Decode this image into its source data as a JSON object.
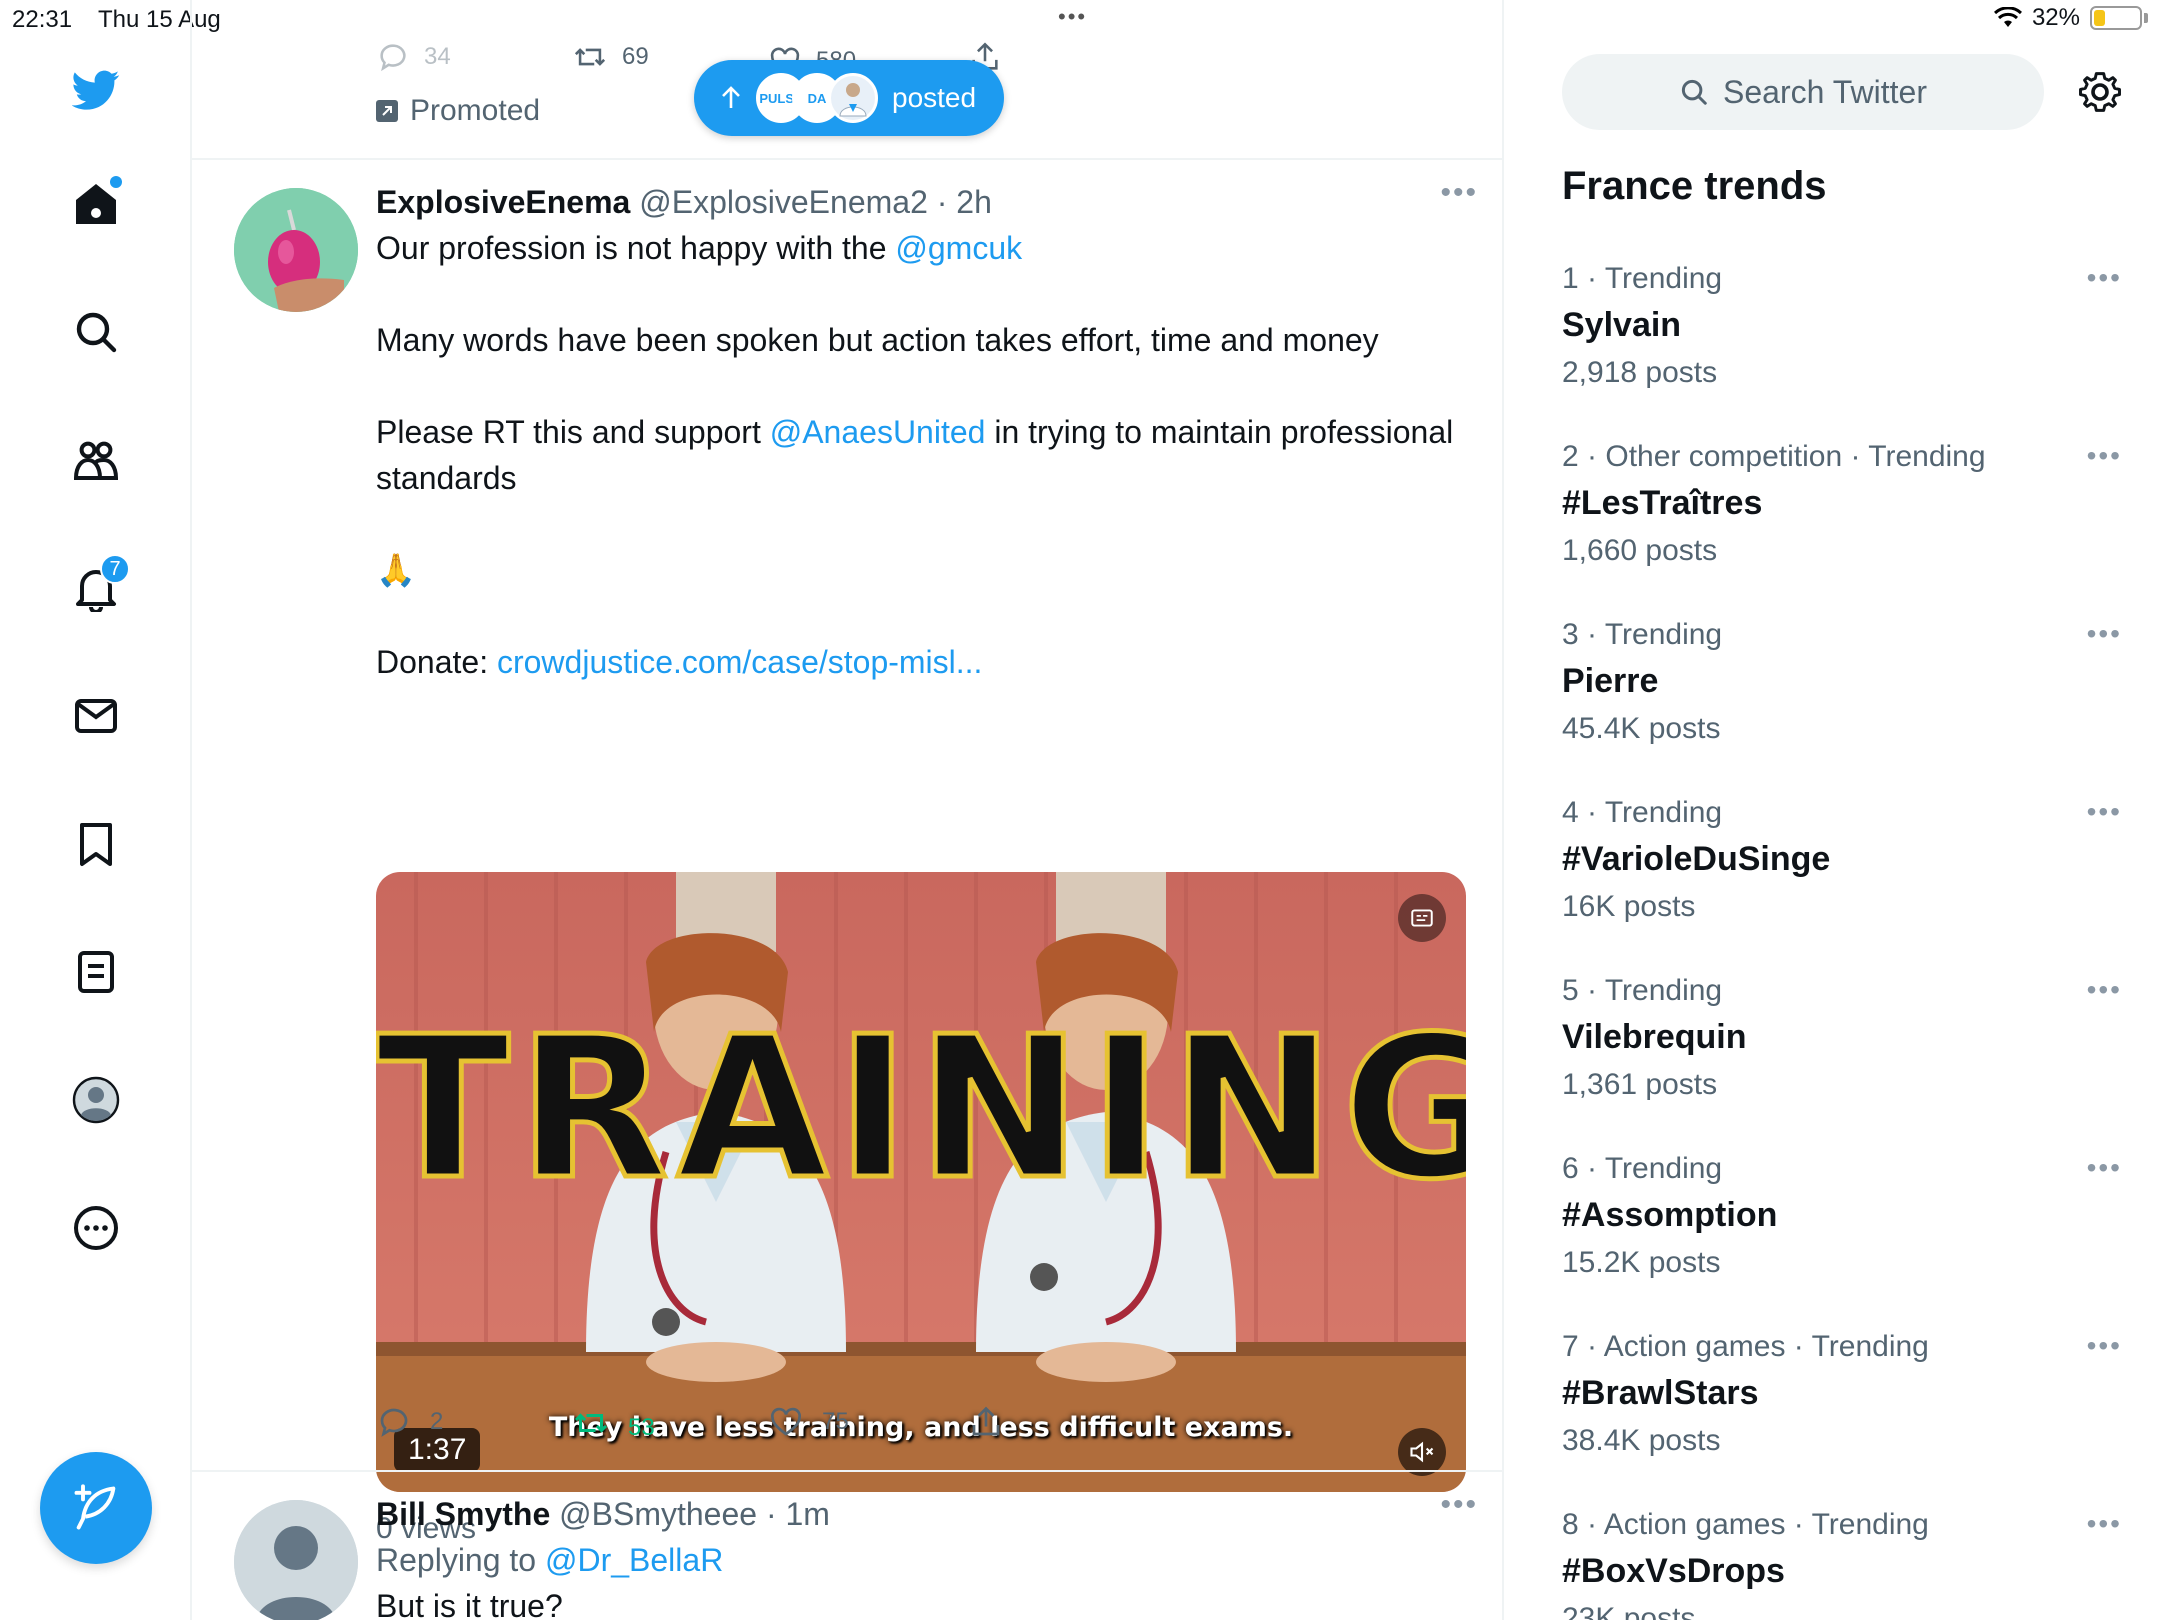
{
  "status_bar": {
    "time": "22:31",
    "date": "Thu 15 Aug",
    "battery": "32%",
    "battery_level": 0.32,
    "battery_color": "#f5c518"
  },
  "nav": {
    "notifications_badge": "7",
    "items": [
      "twitter-logo",
      "home-icon",
      "search-icon",
      "communities-icon",
      "bell-icon",
      "mail-icon",
      "bookmark-icon",
      "lists-icon",
      "profile-icon",
      "more-icon"
    ],
    "accent": "#1d9bf0"
  },
  "prev_tweet": {
    "replies": "34",
    "retweets": "69",
    "likes": "580",
    "promoted": "Promoted"
  },
  "posted_pill": {
    "label": "posted",
    "avatars": [
      "PULSE",
      "DA",
      "doc"
    ]
  },
  "tweet1": {
    "name": "ExplosiveEnema",
    "handle": "@ExplosiveEnema2",
    "time": "2h",
    "line1_prefix": "Our profession is not happy with the ",
    "line1_mention": "@gmcuk",
    "para2": "Many words have been spoken but action takes effort, time and money",
    "para3_prefix": "Please RT this and support ",
    "para3_mention": "@AnaesUnited",
    "para3_suffix": " in trying to maintain professional standards",
    "emoji": "🙏",
    "donate_prefix": "Donate: ",
    "donate_link": "crowdjustice.com/case/stop-misl...",
    "video": {
      "overlay_text": "TRAINING",
      "subtitle": "They have less training, and less difficult exams.",
      "duration": "1:37"
    },
    "views": "0 views",
    "replies": "2",
    "retweets": "53",
    "likes": "75"
  },
  "tweet2": {
    "name": "Bill Smythe",
    "handle": "@BSmytheee",
    "time": "1m",
    "replying_prefix": "Replying to ",
    "replying_to": "@Dr_BellaR",
    "text": "But is it true?"
  },
  "sidebar": {
    "search_placeholder": "Search Twitter",
    "trends_title": "France trends",
    "trends": [
      {
        "rank": "1",
        "context": "Trending",
        "name": "Sylvain",
        "count": "2,918 posts"
      },
      {
        "rank": "2",
        "context": "Other competition · Trending",
        "name": "#LesTraîtres",
        "count": "1,660 posts"
      },
      {
        "rank": "3",
        "context": "Trending",
        "name": "Pierre",
        "count": "45.4K posts"
      },
      {
        "rank": "4",
        "context": "Trending",
        "name": "#VarioleDuSinge",
        "count": "16K posts"
      },
      {
        "rank": "5",
        "context": "Trending",
        "name": "Vilebrequin",
        "count": "1,361 posts"
      },
      {
        "rank": "6",
        "context": "Trending",
        "name": "#Assomption",
        "count": "15.2K posts"
      },
      {
        "rank": "7",
        "context": "Action games · Trending",
        "name": "#BrawlStars",
        "count": "38.4K posts"
      },
      {
        "rank": "8",
        "context": "Action games · Trending",
        "name": "#BoxVsDrops",
        "count": "23K posts"
      }
    ]
  }
}
